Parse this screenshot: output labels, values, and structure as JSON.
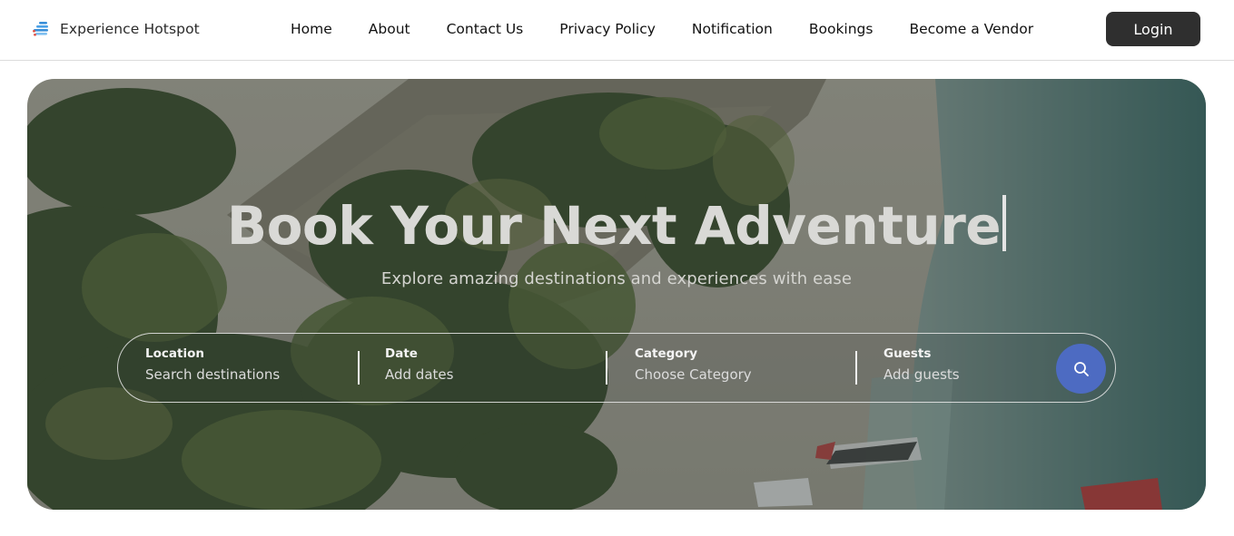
{
  "header": {
    "brand": "Experience Hotspot",
    "nav": [
      {
        "label": "Home"
      },
      {
        "label": "About"
      },
      {
        "label": "Contact Us"
      },
      {
        "label": "Privacy Policy"
      },
      {
        "label": "Notification"
      },
      {
        "label": "Bookings"
      },
      {
        "label": "Become a Vendor"
      }
    ],
    "login_label": "Login"
  },
  "hero": {
    "title": "Book Your Next Adventure",
    "subtitle": "Explore amazing destinations and experiences with ease",
    "search": {
      "location": {
        "label": "Location",
        "placeholder": "Search destinations"
      },
      "date": {
        "label": "Date",
        "placeholder": "Add dates"
      },
      "category": {
        "label": "Category",
        "placeholder": "Choose Category"
      },
      "guests": {
        "label": "Guests",
        "placeholder": "Add guests"
      },
      "button_icon": "search-icon"
    }
  },
  "colors": {
    "login_bg": "#2f2f2f",
    "search_button": "#4d6bc2",
    "brand_logo_blue": "#3a8fd8",
    "brand_logo_red": "#e0564a"
  }
}
